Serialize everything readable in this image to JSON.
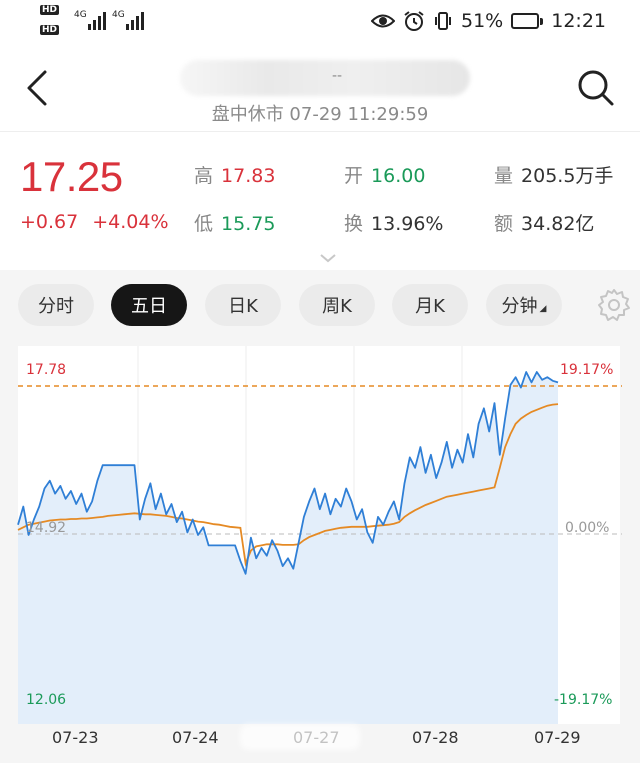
{
  "status_bar": {
    "sim1": "HD",
    "sim2": "HD",
    "net1": "4G",
    "net2": "4G",
    "battery_pct": "51%",
    "battery_level": 0.51,
    "time": "12:21"
  },
  "nav": {
    "title_blurred": "--",
    "subtitle": "盘中休市 07-29 11:29:59"
  },
  "quote": {
    "price": "17.25",
    "change": "+0.67",
    "change_pct": "+4.04%",
    "high_label": "高",
    "high": "17.83",
    "low_label": "低",
    "low": "15.75",
    "open_label": "开",
    "open": "16.00",
    "turnover_label": "换",
    "turnover": "13.96%",
    "volume_label": "量",
    "volume": "205.5万手",
    "amount_label": "额",
    "amount": "34.82亿"
  },
  "tabs": [
    "分时",
    "五日",
    "日K",
    "周K",
    "月K",
    "分钟"
  ],
  "active_tab": "五日",
  "colors": {
    "up": "#d9323b",
    "down": "#1b9a59",
    "price_line": "#2f7fd6",
    "avg_line": "#e58a24",
    "fill": "#e3eefa"
  },
  "chart_data": {
    "type": "line",
    "title": "",
    "x_labels": [
      "07-23",
      "07-24",
      "07-27",
      "07-28",
      "07-29"
    ],
    "ylim": [
      12.06,
      17.78
    ],
    "base": 14.92,
    "high_line": 17.78,
    "left_ticks": [
      "17.78",
      "14.92",
      "12.06"
    ],
    "right_ticks": [
      "19.17%",
      "0.00%",
      "-19.17%"
    ],
    "series": [
      {
        "values": [
          15.1,
          15.45,
          14.9,
          15.2,
          15.45,
          15.8,
          15.95,
          15.7,
          15.85,
          15.6,
          15.75,
          15.5,
          15.7,
          15.35,
          15.55,
          15.95,
          16.25,
          16.25,
          16.25,
          16.25,
          16.25,
          16.25,
          16.25,
          15.2,
          15.6,
          15.9,
          15.4,
          15.7,
          15.3,
          15.5,
          15.15,
          15.35,
          14.95,
          15.2,
          14.9,
          15.05,
          14.7,
          14.7,
          14.7,
          14.7,
          14.7,
          14.7,
          14.4,
          14.15,
          14.85,
          14.45,
          14.65,
          14.5,
          14.8,
          14.6,
          14.3,
          14.45,
          14.25,
          14.75,
          15.25,
          15.55,
          15.8,
          15.4,
          15.7,
          15.3,
          15.6,
          15.45,
          15.8,
          15.55,
          15.2,
          15.4,
          14.95,
          14.75,
          15.25,
          15.1,
          15.35,
          15.55,
          15.2,
          15.9,
          16.4,
          16.2,
          16.6,
          16.1,
          16.45,
          16.0,
          16.3,
          16.7,
          16.2,
          16.55,
          16.3,
          16.85,
          16.4,
          17.05,
          17.35,
          16.9,
          17.45,
          16.45,
          17.15,
          17.8,
          17.95,
          17.75,
          18.05,
          17.85,
          18.05,
          17.9,
          17.95,
          17.88,
          17.85
        ]
      },
      {
        "values": [
          15.0,
          15.05,
          15.1,
          15.12,
          15.14,
          15.16,
          15.18,
          15.19,
          15.2,
          15.2,
          15.21,
          15.21,
          15.22,
          15.22,
          15.23,
          15.24,
          15.25,
          15.27,
          15.28,
          15.29,
          15.3,
          15.31,
          15.32,
          15.31,
          15.3,
          15.3,
          15.29,
          15.28,
          15.27,
          15.25,
          15.23,
          15.22,
          15.2,
          15.18,
          15.16,
          15.15,
          15.13,
          15.11,
          15.1,
          15.08,
          15.06,
          15.05,
          15.04,
          14.35,
          14.6,
          14.68,
          14.7,
          14.72,
          14.72,
          14.72,
          14.71,
          14.71,
          14.71,
          14.72,
          14.8,
          14.86,
          14.9,
          14.94,
          14.98,
          15.0,
          15.02,
          15.04,
          15.05,
          15.06,
          15.06,
          15.06,
          15.06,
          15.07,
          15.08,
          15.09,
          15.1,
          15.12,
          15.15,
          15.25,
          15.32,
          15.38,
          15.43,
          15.48,
          15.52,
          15.56,
          15.6,
          15.64,
          15.66,
          15.68,
          15.7,
          15.72,
          15.74,
          15.76,
          15.78,
          15.8,
          15.82,
          16.2,
          16.6,
          16.85,
          17.05,
          17.15,
          17.22,
          17.28,
          17.32,
          17.36,
          17.4,
          17.42,
          17.43
        ]
      }
    ]
  }
}
